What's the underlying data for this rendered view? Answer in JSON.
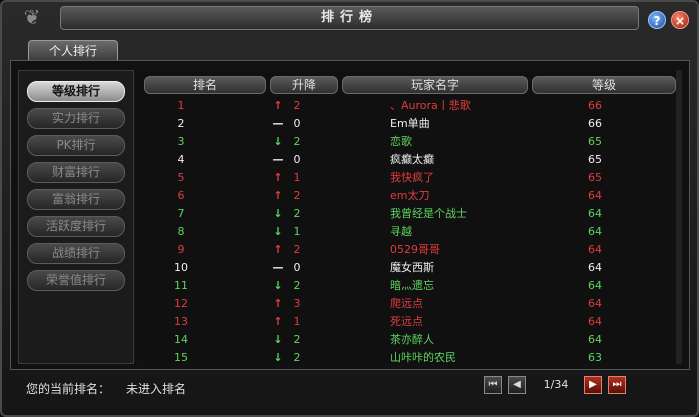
{
  "window": {
    "title": "排行榜"
  },
  "tab": {
    "label": "个人排行"
  },
  "sidebar": {
    "items": [
      {
        "label": "等级排行",
        "active": true
      },
      {
        "label": "实力排行",
        "active": false
      },
      {
        "label": "PK排行",
        "active": false
      },
      {
        "label": "财富排行",
        "active": false
      },
      {
        "label": "富翁排行",
        "active": false
      },
      {
        "label": "活跃度排行",
        "active": false
      },
      {
        "label": "战绩排行",
        "active": false
      },
      {
        "label": "荣誉值排行",
        "active": false
      }
    ]
  },
  "table": {
    "headers": {
      "rank": "排名",
      "change": "升降",
      "name": "玩家名字",
      "level": "等级"
    },
    "rows": [
      {
        "rank": "1",
        "arrow": "↑",
        "delta": "2",
        "name": "、Aurora丨悲歌",
        "level": "66",
        "color": "red",
        "dir": "up"
      },
      {
        "rank": "2",
        "arrow": "—",
        "delta": "0",
        "name": "Em单曲",
        "level": "66",
        "color": "white",
        "dir": "flat"
      },
      {
        "rank": "3",
        "arrow": "↓",
        "delta": "2",
        "name": "恋歌",
        "level": "65",
        "color": "green",
        "dir": "down"
      },
      {
        "rank": "4",
        "arrow": "—",
        "delta": "0",
        "name": "疯癫太癫",
        "level": "65",
        "color": "white",
        "dir": "flat"
      },
      {
        "rank": "5",
        "arrow": "↑",
        "delta": "1",
        "name": "我快疯了",
        "level": "65",
        "color": "red",
        "dir": "up"
      },
      {
        "rank": "6",
        "arrow": "↑",
        "delta": "2",
        "name": "em太刀",
        "level": "64",
        "color": "red",
        "dir": "up"
      },
      {
        "rank": "7",
        "arrow": "↓",
        "delta": "2",
        "name": "我曾经是个战士",
        "level": "64",
        "color": "green",
        "dir": "down"
      },
      {
        "rank": "8",
        "arrow": "↓",
        "delta": "1",
        "name": "寻越",
        "level": "64",
        "color": "green",
        "dir": "down"
      },
      {
        "rank": "9",
        "arrow": "↑",
        "delta": "2",
        "name": "0529哥哥",
        "level": "64",
        "color": "red",
        "dir": "up"
      },
      {
        "rank": "10",
        "arrow": "—",
        "delta": "0",
        "name": "魔女西斯",
        "level": "64",
        "color": "white",
        "dir": "flat"
      },
      {
        "rank": "11",
        "arrow": "↓",
        "delta": "2",
        "name": "暗灬遗忘",
        "level": "64",
        "color": "green",
        "dir": "down"
      },
      {
        "rank": "12",
        "arrow": "↑",
        "delta": "3",
        "name": "爬远点",
        "level": "64",
        "color": "red",
        "dir": "up"
      },
      {
        "rank": "13",
        "arrow": "↑",
        "delta": "1",
        "name": "死远点",
        "level": "64",
        "color": "red",
        "dir": "up"
      },
      {
        "rank": "14",
        "arrow": "↓",
        "delta": "2",
        "name": "茶亦醉人",
        "level": "64",
        "color": "green",
        "dir": "down"
      },
      {
        "rank": "15",
        "arrow": "↓",
        "delta": "2",
        "name": "山咔咔的农民",
        "level": "63",
        "color": "green",
        "dir": "down"
      }
    ]
  },
  "footer": {
    "label": "您的当前排名：",
    "value": "未进入排名",
    "page": "1/34"
  },
  "icons": {
    "help": "question-icon",
    "close": "close-icon",
    "first": "first-page-icon",
    "prev": "prev-page-icon",
    "next": "next-page-icon",
    "last": "last-page-icon"
  },
  "colors": {
    "up": "#e03c3c",
    "down": "#5fd45f",
    "flat": "#f0f0f0"
  }
}
